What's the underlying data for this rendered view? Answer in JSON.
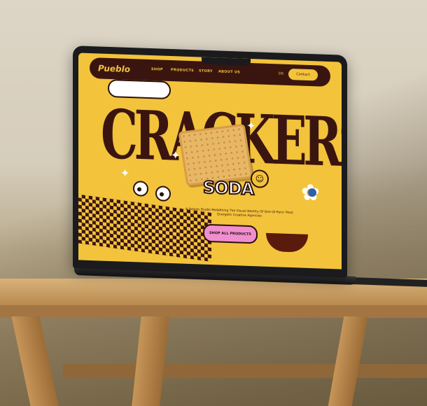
{
  "site": {
    "logo": "Pueblo",
    "nav": [
      "SHOP",
      "PRODUCTS",
      "STORY",
      "ABOUT US"
    ],
    "lang": "EN",
    "contact_label": "Contact",
    "headline": "CRACKERS",
    "subheadline": "SODA",
    "tagline": "A Design Studio Redefining The Visual Identity Of One Of Paris' Most Energetic Creative Agencies",
    "cta_label": "SHOP ALL PRODUCTS"
  },
  "colors": {
    "brand_yellow": "#f3c33b",
    "brand_brown": "#3a1510",
    "cta_pink": "#f08fd0"
  },
  "icons": [
    "cloud-icon",
    "cracker-image",
    "eyes-icon",
    "smiley-icon",
    "flower-icon",
    "sparkle-icon",
    "checkerboard-pattern",
    "cup-illustration"
  ]
}
